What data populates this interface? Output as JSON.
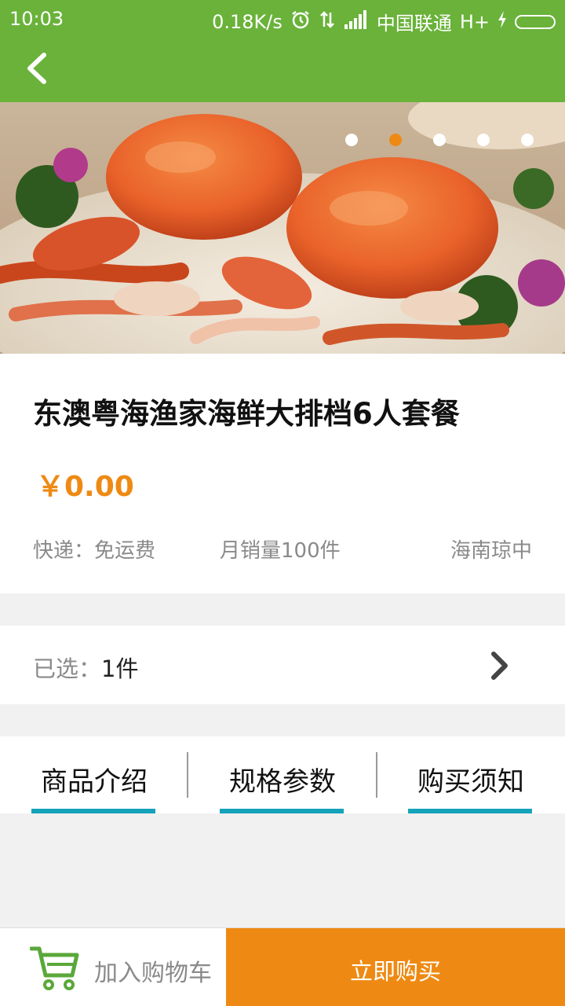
{
  "status_bar": {
    "time": "10:03",
    "net_speed": "0.18K/s",
    "carrier": "中国联通",
    "network": "H+",
    "icons": [
      "alarm-icon",
      "data-transfer-icon",
      "signal-icon",
      "charging-icon",
      "battery-icon"
    ]
  },
  "nav": {
    "back_icon": "back-arrow-icon"
  },
  "carousel": {
    "slide_count": 5,
    "active_index": 1
  },
  "product": {
    "title": "东澳粤海渔家海鲜大排档6人套餐",
    "price": "￥0.00",
    "shipping": "快递：免运费",
    "monthly_sales": "月销量100件",
    "location": "海南琼中"
  },
  "selection": {
    "label": "已选：",
    "value": "1件"
  },
  "tabs": [
    {
      "label": "商品介绍"
    },
    {
      "label": "规格参数"
    },
    {
      "label": "购买须知"
    }
  ],
  "actions": {
    "add_to_cart": "加入购物车",
    "buy_now": "立即购买"
  },
  "colors": {
    "brand_green": "#6ab23a",
    "accent_orange": "#ee8a13",
    "tab_underline": "#15a3bb"
  }
}
